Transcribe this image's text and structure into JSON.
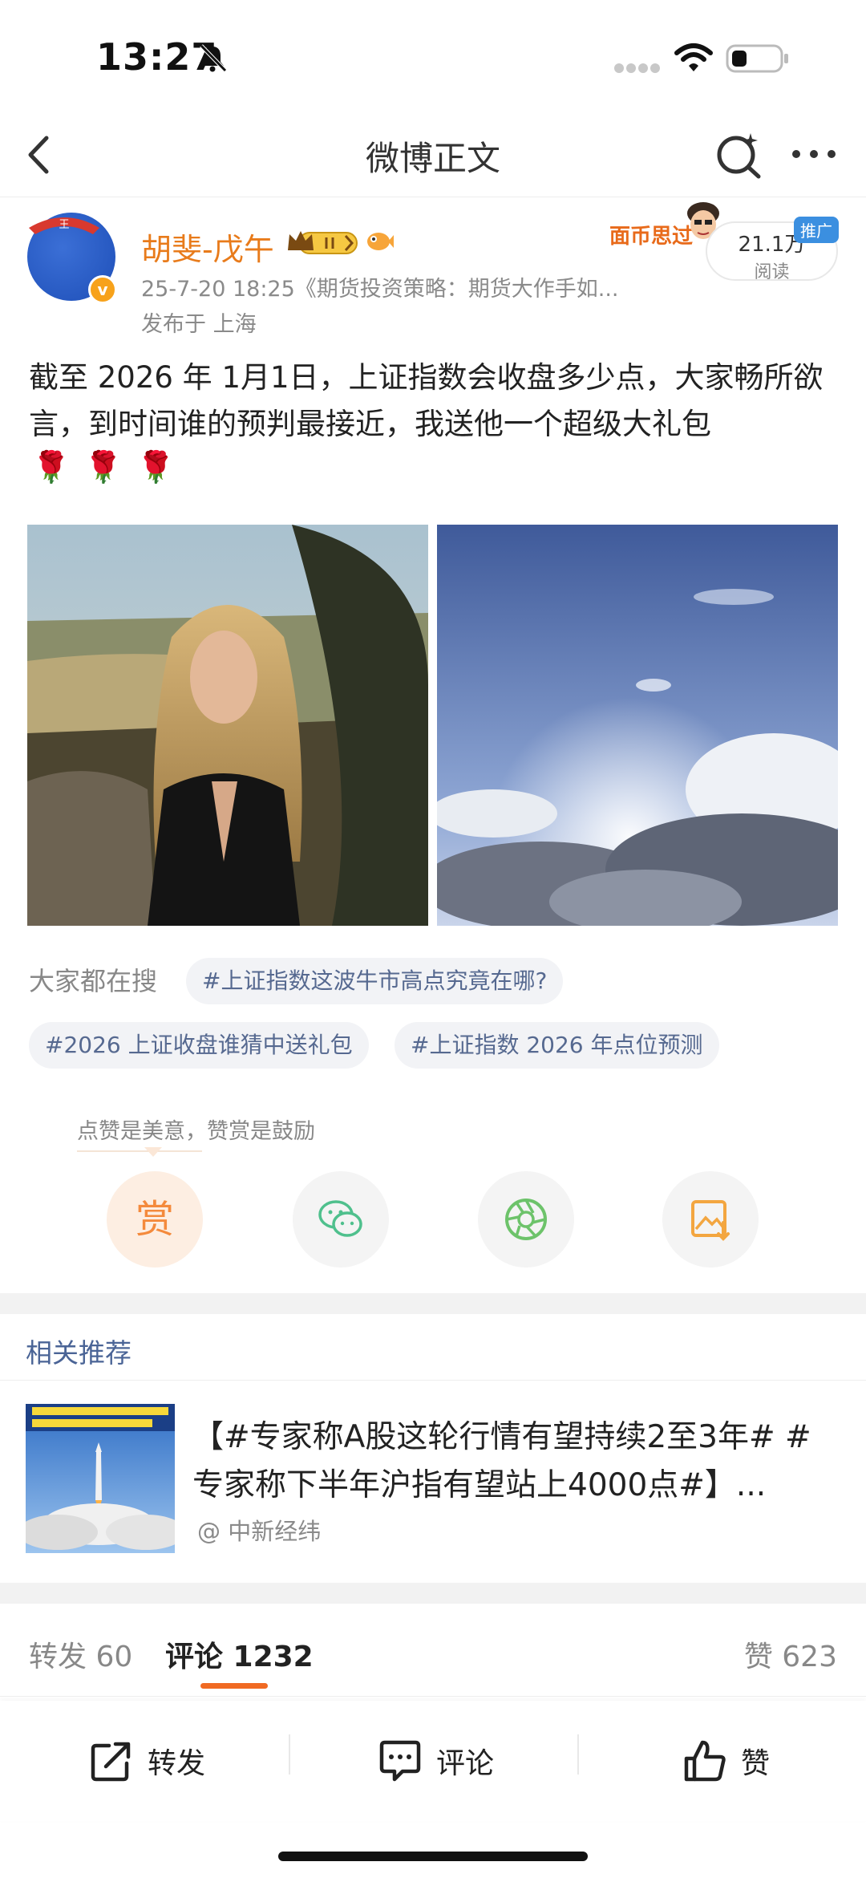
{
  "status_bar": {
    "time": "13:27"
  },
  "nav": {
    "title": "微博正文"
  },
  "post": {
    "author": "胡斐-戊午",
    "avatar_text": "王",
    "verified_mark": "v",
    "meta": "25-7-20 18:25《期货投资策略：期货大作手如...",
    "location": "发布于 上海",
    "sticker_text": "面币思过",
    "read_count": "21.1万",
    "read_label": "阅读",
    "promo_tag": "推广",
    "text": "截至 2026 年 1月1日，上证指数会收盘多少点，大家畅所欲言，到时间谁的预判最接近，我送他一个超级大礼包",
    "emoji": "🌹🌹🌹"
  },
  "search": {
    "label": "大家都在搜",
    "topics": [
      "#上证指数这波牛市高点究竟在哪?",
      "#2026 上证收盘谁猜中送礼包",
      "#上证指数 2026 年点位预测"
    ]
  },
  "reward": {
    "tip": "点赞是美意，赞赏是鼓励",
    "reward_label": "赏"
  },
  "related": {
    "title": "相关推荐",
    "headline": "【#专家称A股这轮行情有望持续2至3年# #专家称下半年沪指有望站上4000点#】...",
    "source": "@ 中新经纬"
  },
  "tabs": {
    "repost": "转发 60",
    "comment": "评论 1232",
    "like": "赞 623"
  },
  "actions": {
    "repost": "转发",
    "comment": "评论",
    "like": "赞"
  }
}
